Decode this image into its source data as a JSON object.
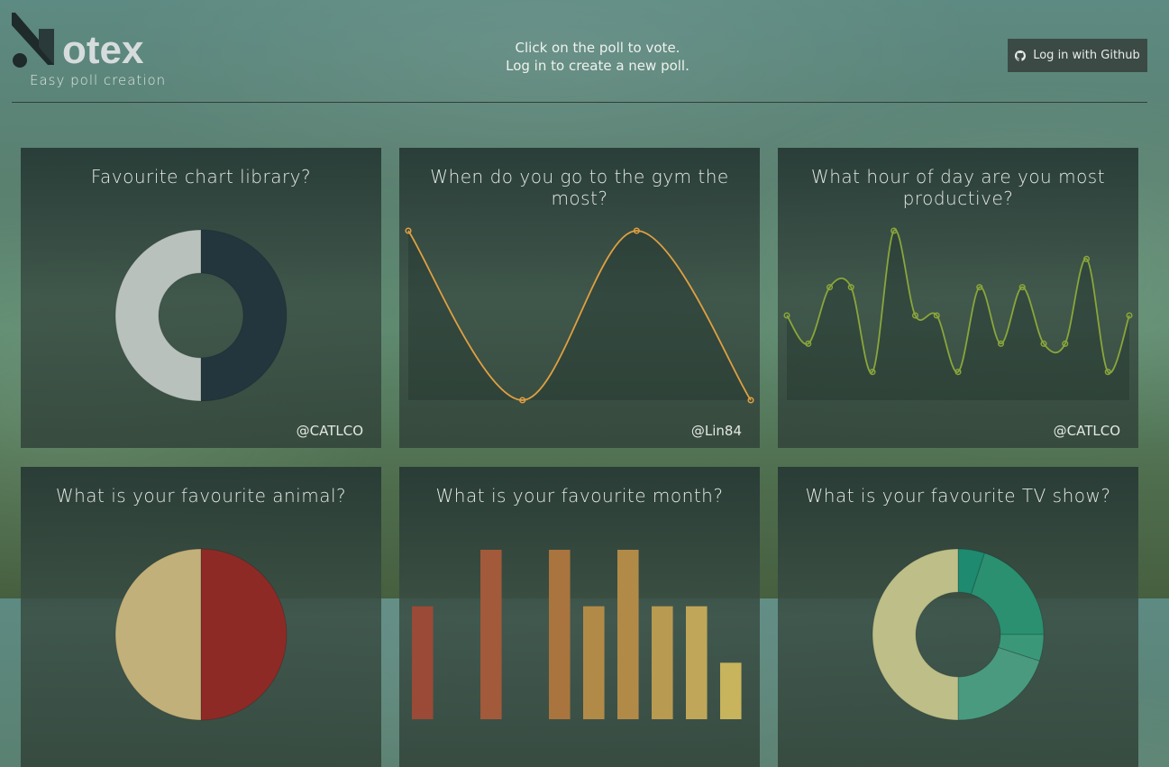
{
  "app": {
    "logo_text": "otex",
    "tagline": "Easy poll creation",
    "message_line1": "Click on the poll to vote.",
    "message_line2": "Log in to create a new poll.",
    "login_label": "Log in with Github",
    "login_icon": "github-icon"
  },
  "polls": [
    {
      "title": "Favourite chart library?",
      "author": "@CATLCO"
    },
    {
      "title": "When do you go to the gym the most?",
      "author": "@Lin84"
    },
    {
      "title": "What hour of day are you most productive?",
      "author": "@CATLCO"
    },
    {
      "title": "What is your favourite animal?",
      "author": ""
    },
    {
      "title": "What is your favourite month?",
      "author": ""
    },
    {
      "title": "What is your favourite TV show?",
      "author": ""
    }
  ],
  "chart_data": [
    {
      "type": "pie",
      "values": [
        50,
        50
      ],
      "colors": [
        "#23353d",
        "#b8c1bb"
      ],
      "donut": true
    },
    {
      "type": "line",
      "values": [
        3,
        0,
        3,
        0
      ],
      "color": "#e0a040",
      "ylim": [
        0,
        3
      ]
    },
    {
      "type": "line",
      "values": [
        3,
        2,
        4,
        4,
        1,
        6,
        3,
        3,
        1,
        4,
        2,
        4,
        2,
        2,
        5,
        1,
        3
      ],
      "color": "#8aa63a",
      "ylim": [
        0,
        6
      ]
    },
    {
      "type": "pie",
      "values": [
        50,
        50
      ],
      "colors": [
        "#8e2a25",
        "#c2b07a"
      ],
      "donut": false
    },
    {
      "type": "bar",
      "values": [
        2,
        0,
        3,
        0,
        3,
        2,
        3,
        2,
        2,
        1
      ],
      "colors": [
        "#9a4a36",
        "#9a4a36",
        "#a25a3a",
        "#a25a3a",
        "#a9743e",
        "#b28a48",
        "#b28a48",
        "#b89a50",
        "#c0a658",
        "#c8b45c"
      ],
      "ylim": [
        0,
        3
      ]
    },
    {
      "type": "pie",
      "values": [
        5,
        20,
        5,
        20,
        50
      ],
      "colors": [
        "#1e8a70",
        "#2a9070",
        "#3a9878",
        "#4a9a80",
        "#bdbe88"
      ],
      "donut": true
    }
  ]
}
